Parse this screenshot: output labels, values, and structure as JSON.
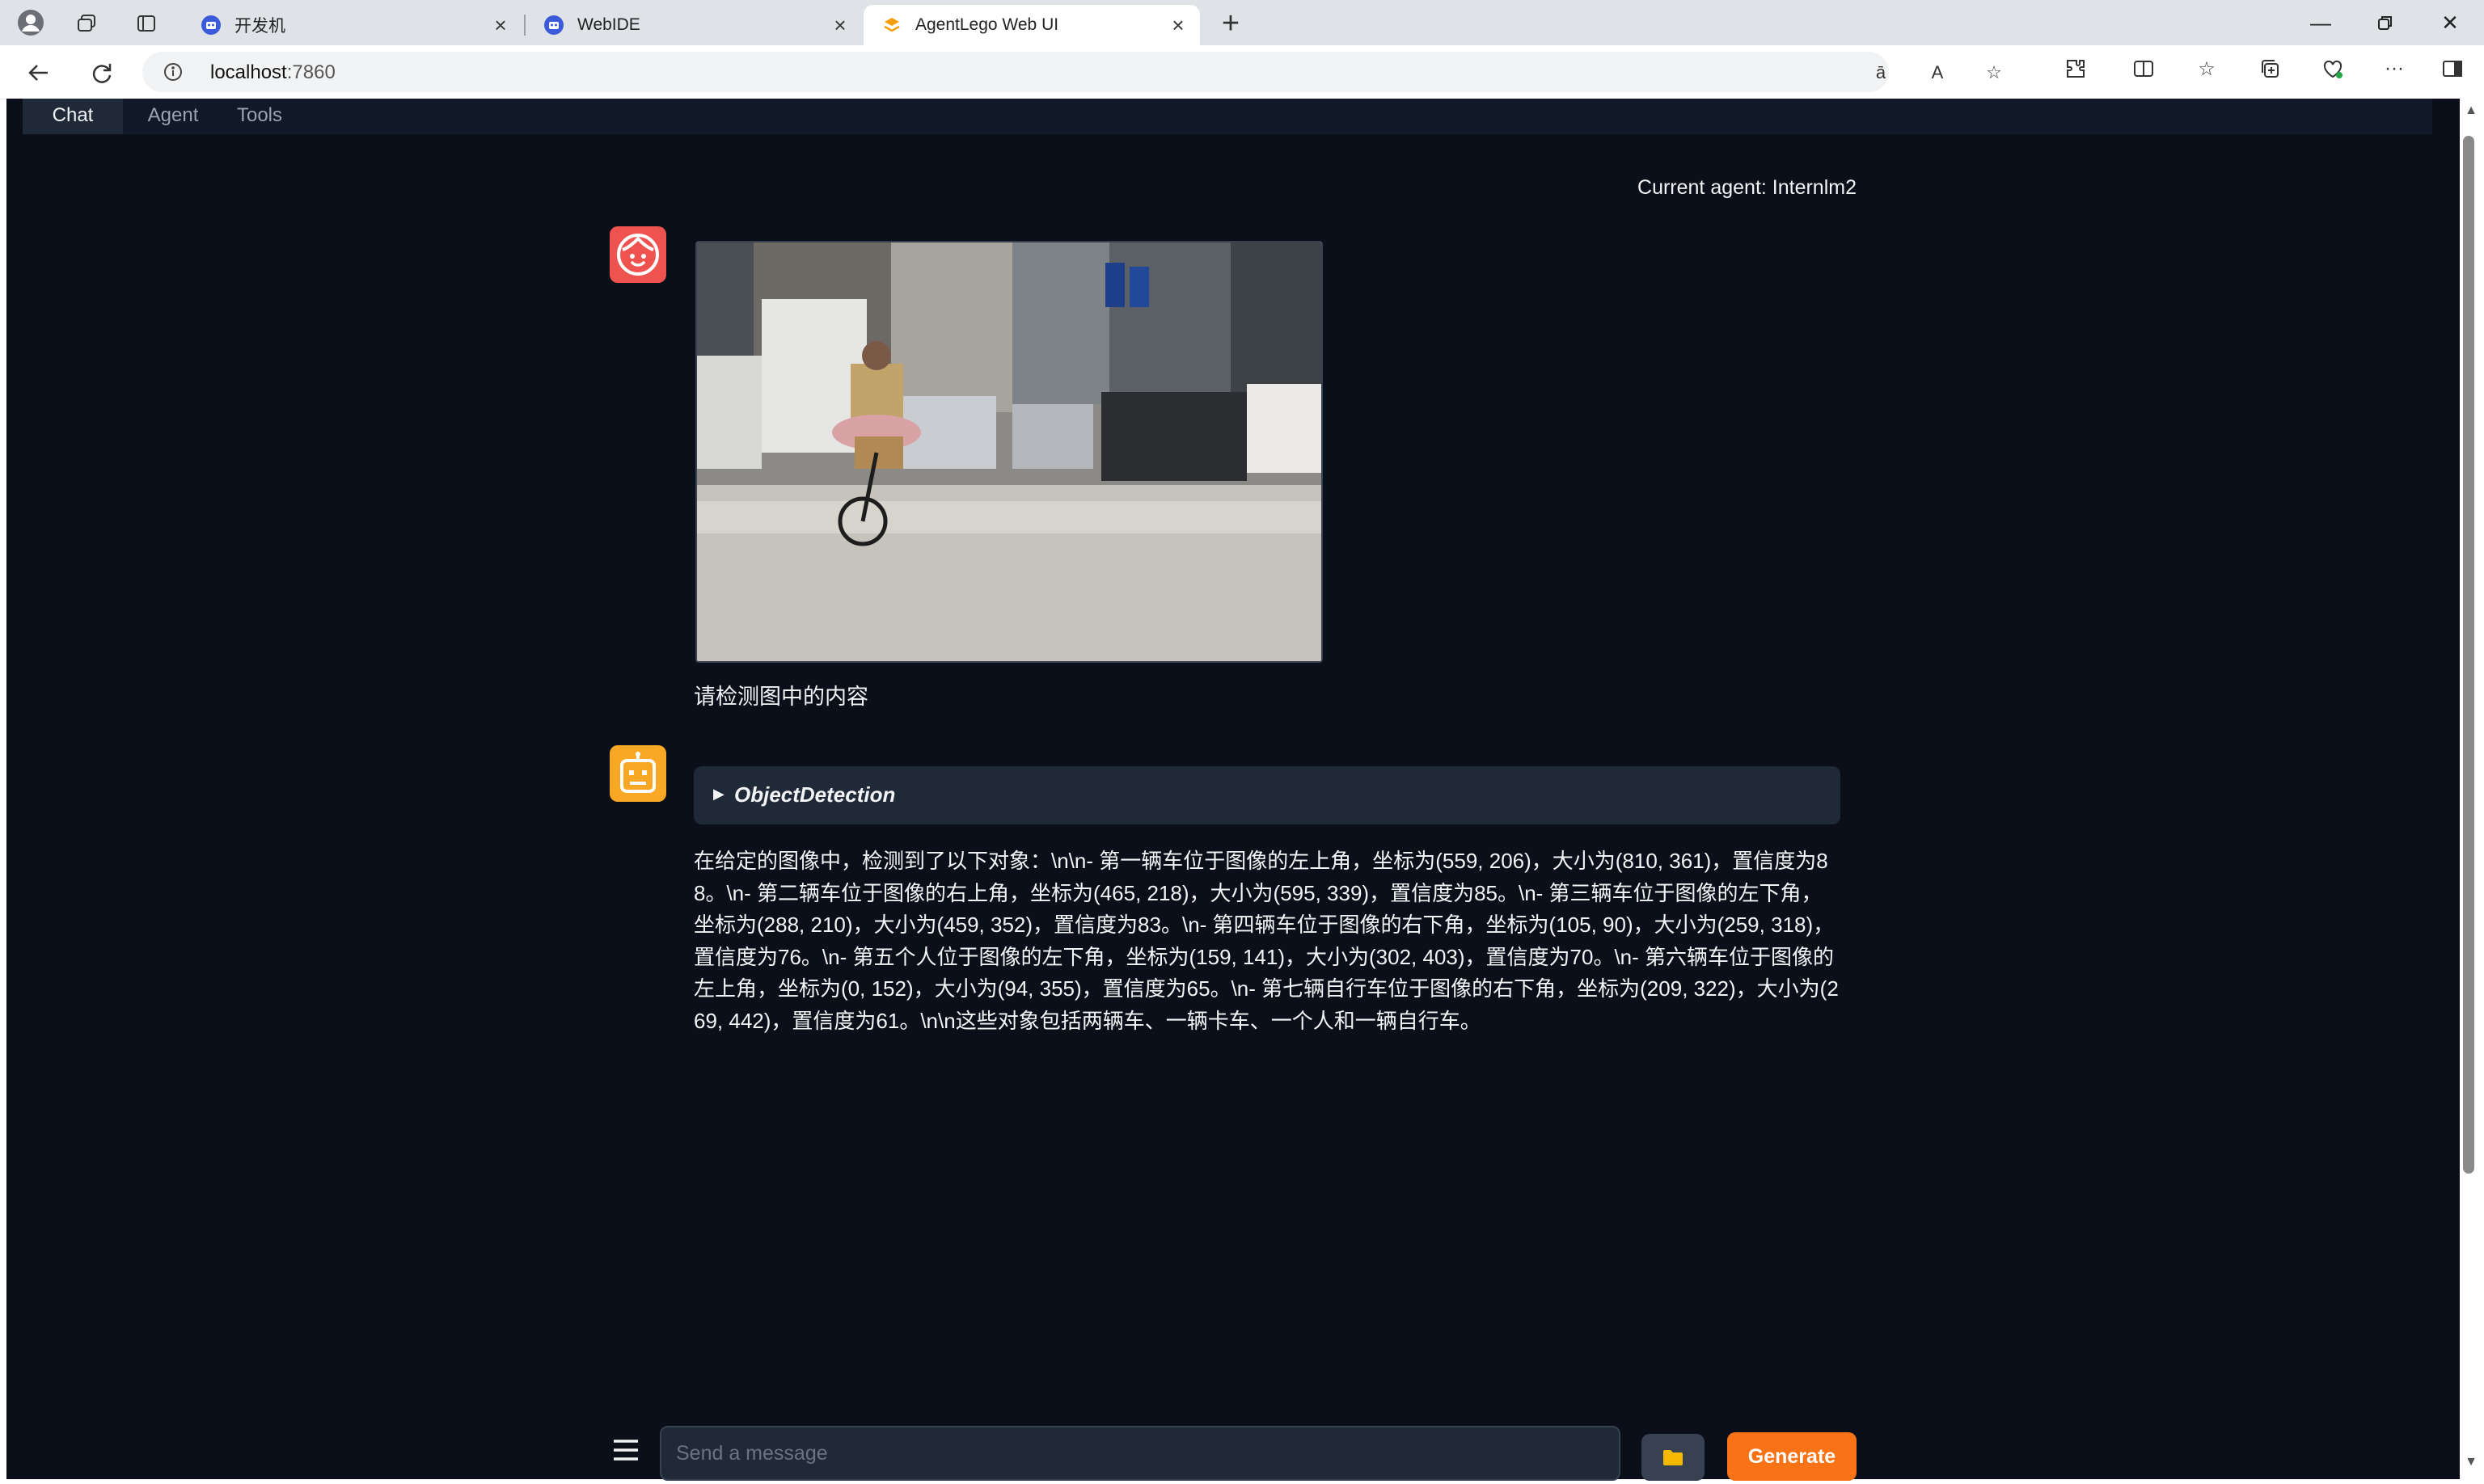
{
  "browser": {
    "tabs": [
      {
        "title": "开发机"
      },
      {
        "title": "WebIDE"
      },
      {
        "title": "AgentLego Web UI"
      }
    ],
    "url_host": "localhost",
    "url_port": ":7860"
  },
  "app": {
    "tabs": [
      "Chat",
      "Agent",
      "Tools"
    ],
    "current_agent": "Current agent: Internlm2",
    "user_message": "请检测图中的内容",
    "tool_name": "ObjectDetection",
    "bot_message": "在给定的图像中，检测到了以下对象：\\n\\n- 第一辆车位于图像的左上角，坐标为(559, 206)，大小为(810, 361)，置信度为88。\\n- 第二辆车位于图像的右上角，坐标为(465, 218)，大小为(595, 339)，置信度为85。\\n- 第三辆车位于图像的左下角，坐标为(288, 210)，大小为(459, 352)，置信度为83。\\n- 第四辆车位于图像的右下角，坐标为(105, 90)，大小为(259, 318)，置信度为76。\\n- 第五个人位于图像的左下角，坐标为(159, 141)，大小为(302, 403)，置信度为70。\\n- 第六辆车位于图像的左上角，坐标为(0, 152)，大小为(94, 355)，置信度为65。\\n- 第七辆自行车位于图像的右下角，坐标为(209, 322)，大小为(269, 442)，置信度为61。\\n\\n这些对象包括两辆车、一辆卡车、一个人和一辆自行车。",
    "input_placeholder": "Send a message",
    "generate_label": "Generate"
  },
  "colors": {
    "background": "#0b0f19",
    "accent": "#f97316",
    "user_avatar": "#ef5350",
    "bot_avatar": "#f9a825"
  }
}
